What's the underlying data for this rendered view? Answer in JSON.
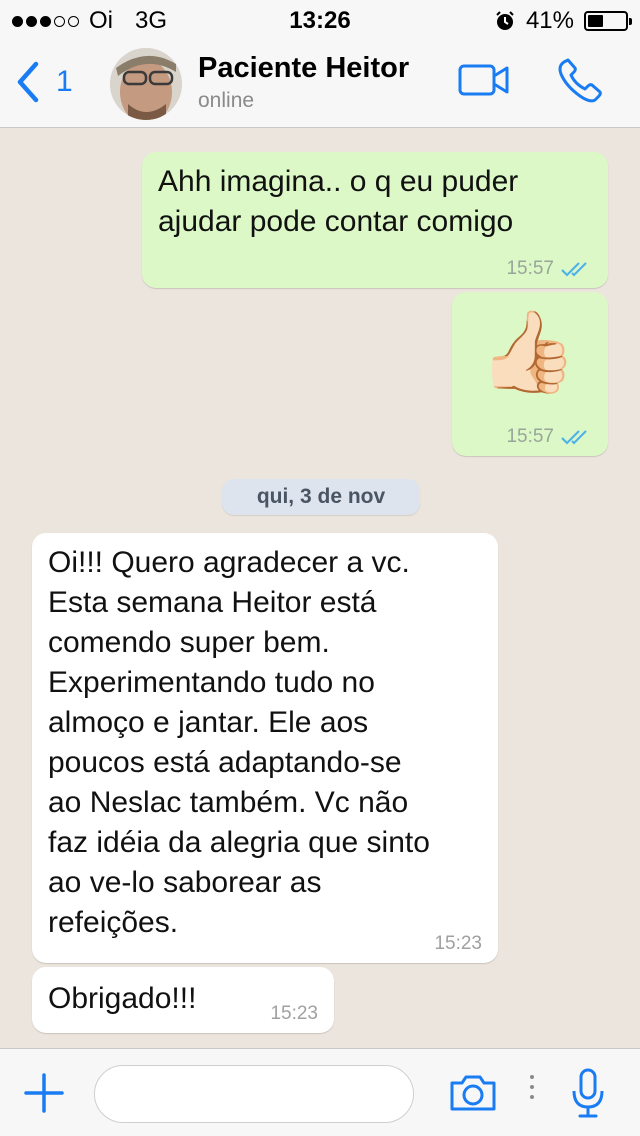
{
  "status_bar": {
    "carrier": "Oi",
    "network": "3G",
    "time": "13:26",
    "battery": "41%",
    "battery_level": 0.41,
    "signal_bars_filled": 3,
    "signal_bars_total": 5,
    "icons": [
      "signal-icon",
      "alarm-icon",
      "battery-icon"
    ]
  },
  "header": {
    "back_count": "1",
    "contact_name": "Paciente Heitor",
    "contact_status": "online",
    "icons": [
      "back-chevron-icon",
      "video-call-icon",
      "phone-call-icon"
    ]
  },
  "messages": [
    {
      "direction": "outgoing",
      "text_lines": [
        "Ahh imagina.. o q eu puder",
        "ajudar pode contar comigo"
      ],
      "time": "15:57",
      "read": true
    },
    {
      "direction": "outgoing",
      "emoji": "👍🏻",
      "time": "15:57",
      "read": true
    },
    {
      "direction": "incoming",
      "text_lines": [
        "Oi!!!  Quero agradecer a vc.",
        "Esta semana Heitor está",
        "comendo super bem.",
        "Experimentando tudo no",
        "almoço e jantar.  Ele aos",
        "poucos está adaptando-se",
        "ao Neslac também.  Vc não",
        "faz idéia da alegria que sinto",
        "ao ve-lo saborear as",
        "refeições."
      ],
      "time": "15:23"
    },
    {
      "direction": "incoming",
      "text_lines": [
        "Obrigado!!!"
      ],
      "time": "15:23"
    }
  ],
  "date_separator": "qui, 3 de nov",
  "input": {
    "value": "",
    "placeholder": "",
    "icons": [
      "plus-icon",
      "camera-icon",
      "more-icon",
      "microphone-icon"
    ]
  },
  "colors": {
    "accent": "#1a7cf3",
    "outgoing_bubble": "#dcf8c6",
    "incoming_bubble": "#ffffff",
    "chat_background": "#ece5dd",
    "read_ticks": "#4fb3e8"
  }
}
